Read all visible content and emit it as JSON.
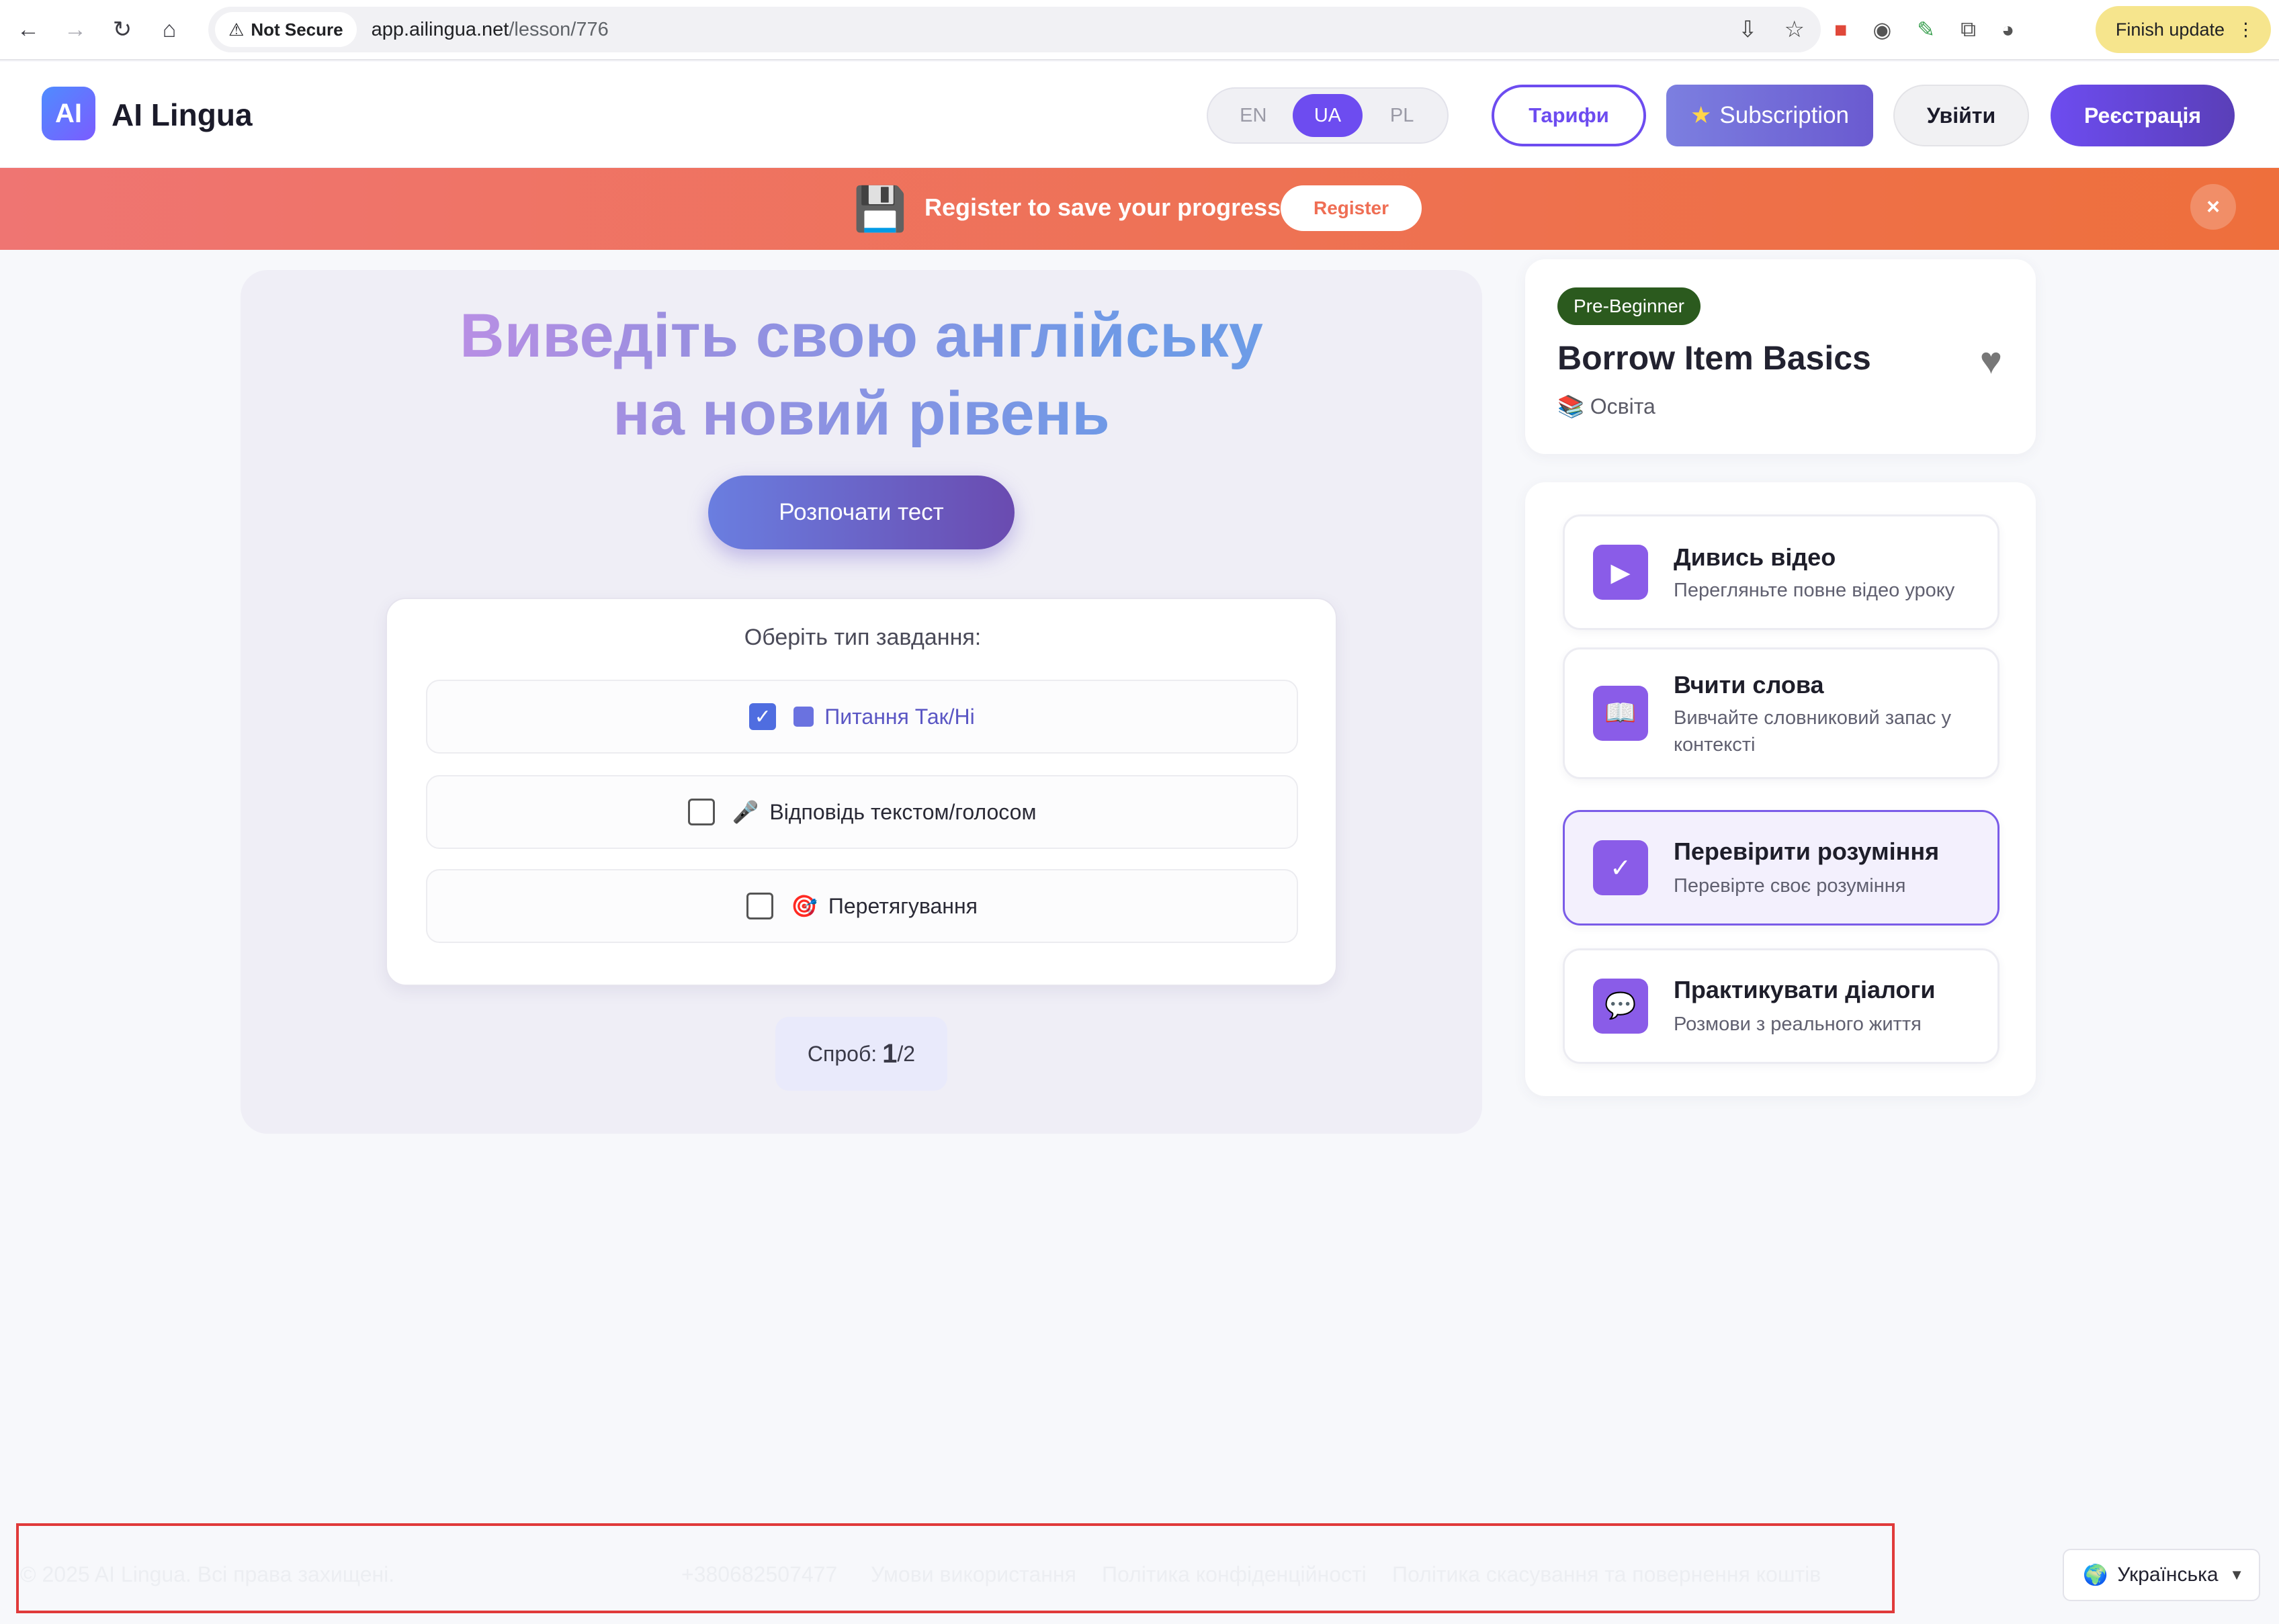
{
  "browser": {
    "security_label": "Not Secure",
    "url_host": "app.ailingua.net",
    "url_path": "/lesson/776",
    "finish_update_label": "Finish update"
  },
  "header": {
    "brand_logo_text": "AI",
    "brand_name": "AI Lingua",
    "languages": [
      "EN",
      "UA",
      "PL"
    ],
    "active_language": "UA",
    "tariffs_label": "Тарифи",
    "subscription_label": "Subscription",
    "login_label": "Увійти",
    "register_label": "Реєстрація"
  },
  "banner": {
    "text": "Register to save your progress",
    "button_label": "Register",
    "close_label": "×"
  },
  "main": {
    "hero_title": "Виведіть свою англійську на новий рівень",
    "start_button_label": "Розпочати тест",
    "task_type_title": "Оберіть тип завдання:",
    "task_types": [
      {
        "label": "Питання Так/Ні",
        "checked": true
      },
      {
        "label": "Відповідь текстом/голосом",
        "checked": false
      },
      {
        "label": "Перетягування",
        "checked": false
      }
    ],
    "attempts_label": "Спроб:",
    "attempts_current": "1",
    "attempts_total": "/2"
  },
  "lesson": {
    "level": "Pre-Beginner",
    "title": "Borrow Item Basics",
    "category": "Освіта"
  },
  "menu": [
    {
      "title": "Дивись відео",
      "subtitle": "Перегляньте повне відео уроку",
      "icon": "play-icon",
      "active": false
    },
    {
      "title": "Вчити слова",
      "subtitle": "Вивчайте словниковий запас у контексті",
      "icon": "book-icon",
      "active": false
    },
    {
      "title": "Перевірити розуміння",
      "subtitle": "Перевірте своє розуміння",
      "icon": "check-icon",
      "active": true
    },
    {
      "title": "Практикувати діалоги",
      "subtitle": "Розмови з реального життя",
      "icon": "chat-icon",
      "active": false
    }
  ],
  "footer": {
    "copyright": "© 2025 AI Lingua. Всі права захищені.",
    "phone": "+380682507477",
    "terms": "Умови використання",
    "privacy": "Політика конфіденційності",
    "refund": "Політика скасування та повернення коштів",
    "language_select": "Українська"
  },
  "colors": {
    "accent": "#6d4cf0",
    "banner": "#ee6f3c",
    "level_badge": "#2b5a1e",
    "highlight_box": "#e03a3a"
  }
}
